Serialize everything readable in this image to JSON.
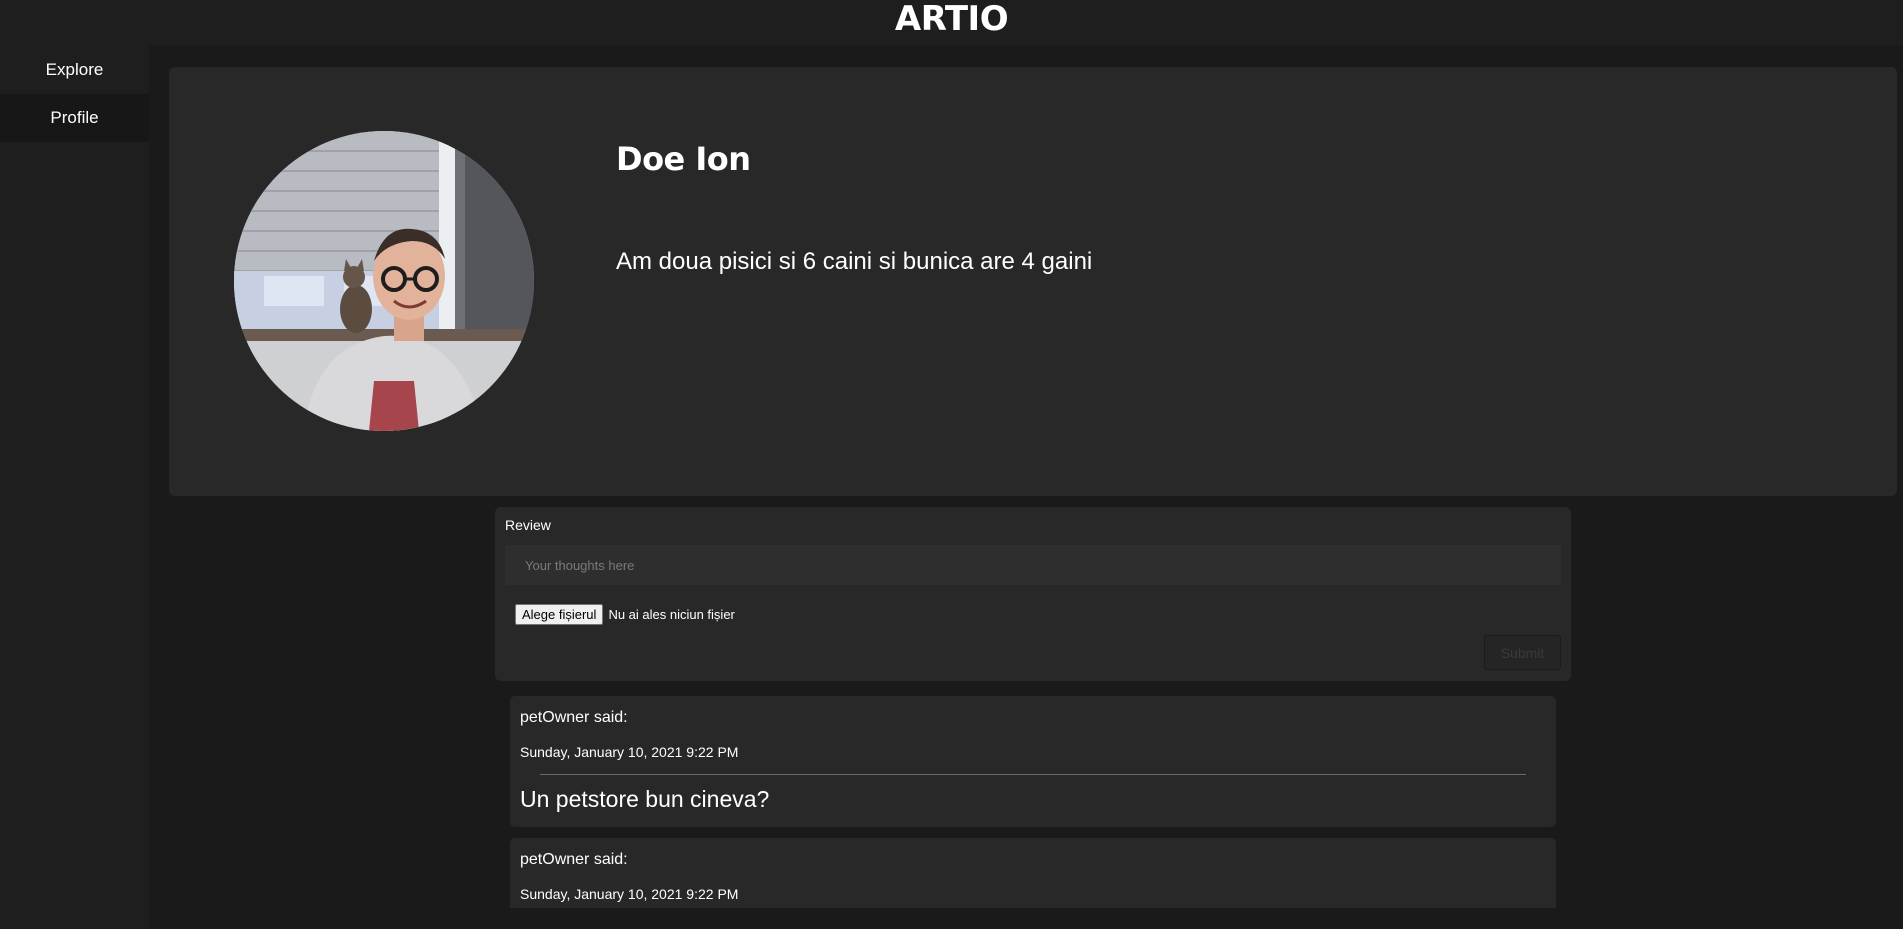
{
  "header": {
    "brand": "ARTIO"
  },
  "sidebar": {
    "items": [
      {
        "label": "Explore"
      },
      {
        "label": "Profile"
      }
    ]
  },
  "profile": {
    "name": "Doe Ion",
    "bio": "Am doua pisici si 6 caini si bunica are 4 gaini"
  },
  "review_form": {
    "label": "Review",
    "placeholder": "Your thoughts here",
    "value": "",
    "file_button_label": "Alege fișierul",
    "file_status": "Nu ai ales niciun fișier",
    "submit_label": "Submit"
  },
  "posts": [
    {
      "author_line": "petOwner said:",
      "date": "Sunday, January 10, 2021 9:22 PM",
      "body": "Un petstore bun cineva?"
    },
    {
      "author_line": "petOwner said:",
      "date": "Sunday, January 10, 2021 9:22 PM",
      "body": ""
    }
  ],
  "colors": {
    "page_background": "#1a1a1a",
    "panel_background": "#282828",
    "sidebar_background": "#1e1e1e",
    "sidebar_active": "#171717",
    "text": "#ffffff"
  }
}
